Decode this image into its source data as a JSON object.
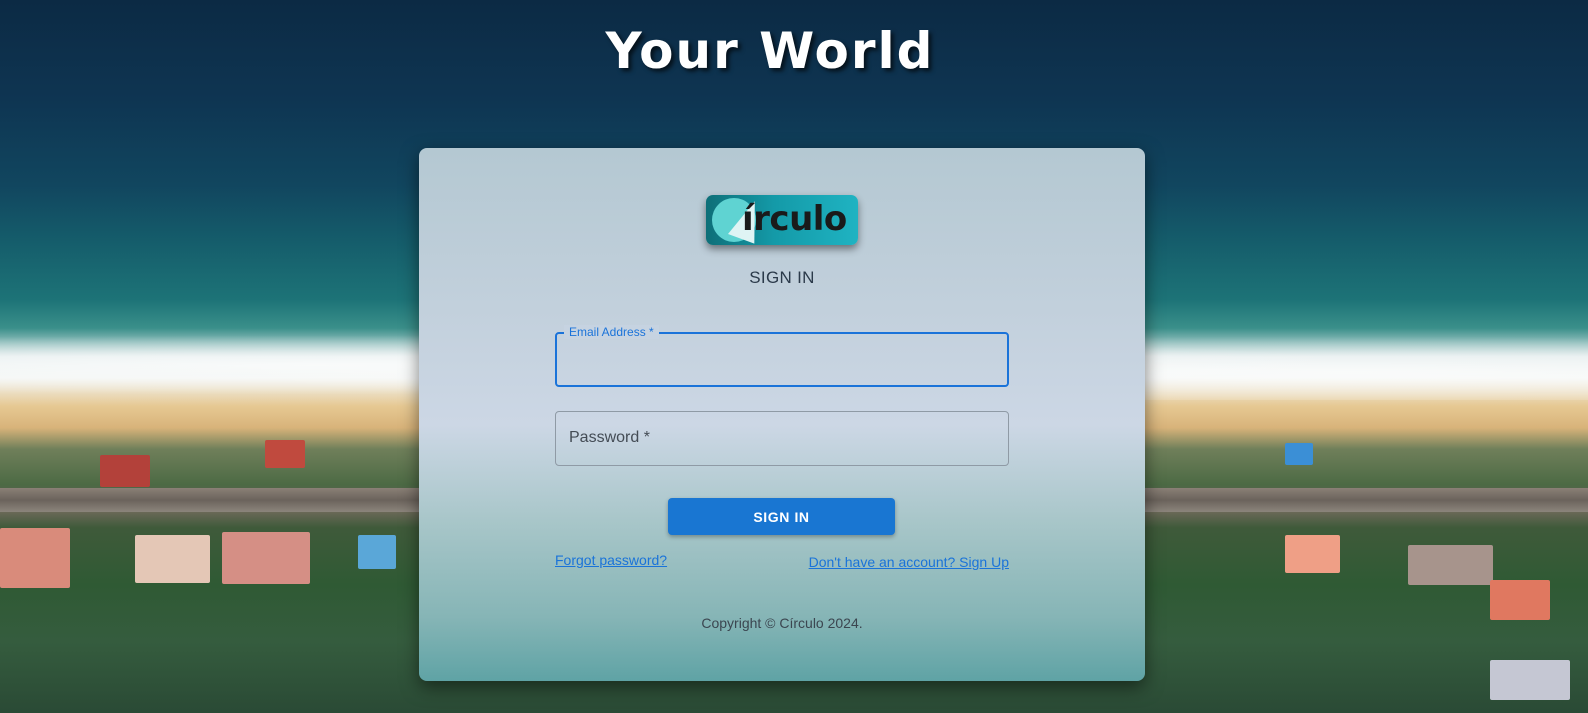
{
  "page": {
    "title": "Your World"
  },
  "login": {
    "logo_text": "írculo",
    "heading": "SIGN IN",
    "email": {
      "label": "Email Address *",
      "value": ""
    },
    "password": {
      "label": "Password *",
      "value": ""
    },
    "submit_label": "SIGN IN",
    "forgot_link": "Forgot password?",
    "signup_link": "Don't have an account? Sign Up",
    "copyright": "Copyright © Círculo 2024."
  },
  "colors": {
    "primary": "#1976d2",
    "link": "#1a73d9",
    "logo_bg": "#149aa8"
  }
}
